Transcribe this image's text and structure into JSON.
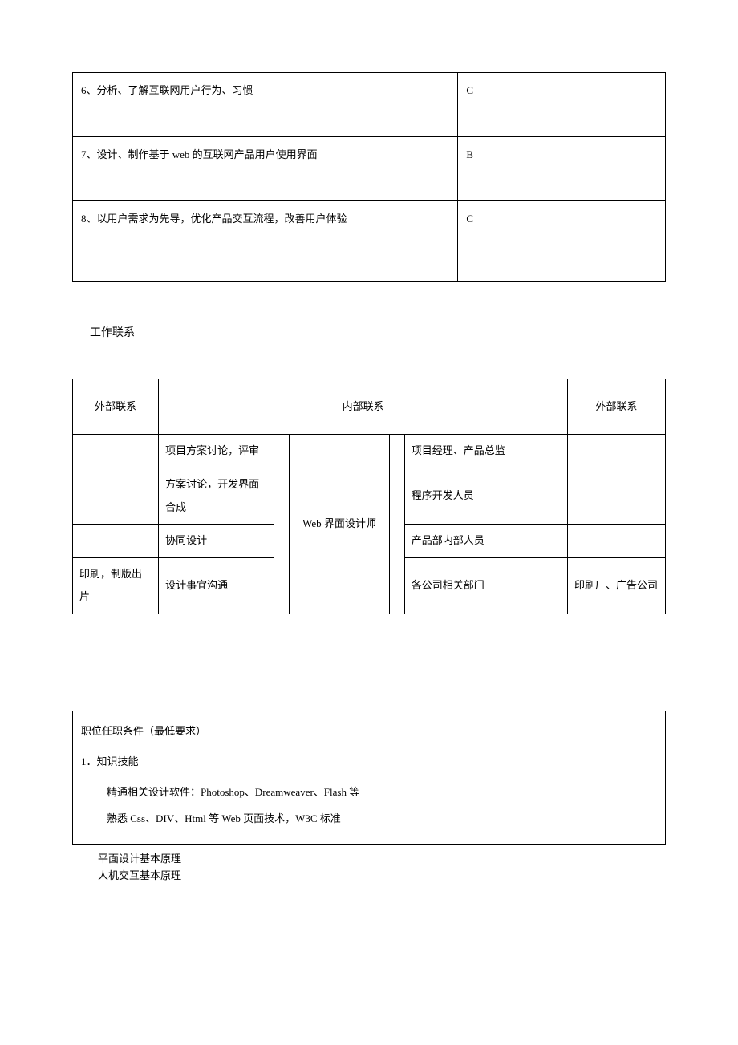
{
  "tasks": {
    "rows": [
      {
        "text": "6、分析、了解互联网用户行为、习惯",
        "level": "C"
      },
      {
        "text": "7、设计、制作基于 web 的互联网产品用户使用界面",
        "level": "B"
      },
      {
        "text": "8、以用户需求为先导，优化产品交互流程，改善用户体验",
        "level": "C"
      }
    ]
  },
  "contacts_heading": "工作联系",
  "contacts": {
    "header": {
      "ext_left": "外部联系",
      "int": "内部联系",
      "ext_right": "外部联系"
    },
    "center_role": "Web 界面设计师",
    "rows": [
      {
        "a": "",
        "b": "项目方案讨论，评审",
        "f": "项目经理、产品总监",
        "g": ""
      },
      {
        "a": "",
        "b": "方案讨论，开发界面合成",
        "f": "程序开发人员",
        "g": ""
      },
      {
        "a": "",
        "b": "协同设计",
        "f": "产品部内部人员",
        "g": ""
      },
      {
        "a": "印刷，制版出片",
        "b": "设计事宜沟通",
        "f": "各公司相关部门",
        "g": "印刷厂、广告公司"
      }
    ]
  },
  "requirements": {
    "title": "职位任职条件（最低要求）",
    "section": "1．知识技能",
    "items": [
      "精通相关设计软件：Photoshop、Dreamweaver、Flash 等",
      "熟悉 Css、DIV、Html 等 Web 页面技术，W3C 标准"
    ],
    "after": [
      "平面设计基本原理",
      "人机交互基本原理"
    ]
  }
}
